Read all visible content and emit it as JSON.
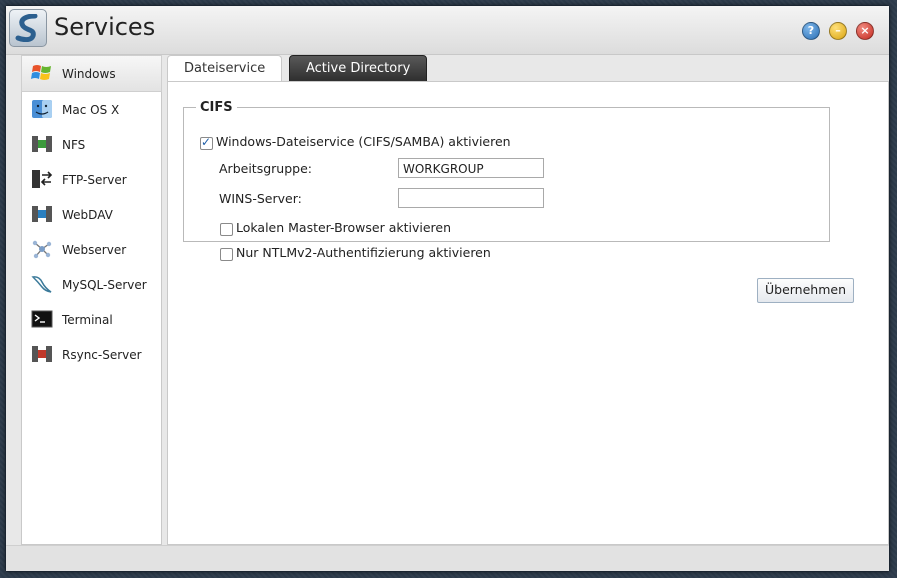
{
  "window": {
    "title": "Services"
  },
  "sidebar": {
    "items": [
      {
        "label": "Windows",
        "icon": "windows-logo-icon",
        "active": true
      },
      {
        "label": "Mac OS X",
        "icon": "mac-finder-icon"
      },
      {
        "label": "NFS",
        "icon": "nfs-server-icon"
      },
      {
        "label": "FTP-Server",
        "icon": "ftp-server-icon"
      },
      {
        "label": "WebDAV",
        "icon": "webdav-server-icon"
      },
      {
        "label": "Webserver",
        "icon": "webserver-icon"
      },
      {
        "label": "MySQL-Server",
        "icon": "mysql-dolphin-icon"
      },
      {
        "label": "Terminal",
        "icon": "terminal-icon"
      },
      {
        "label": "Rsync-Server",
        "icon": "rsync-server-icon"
      }
    ]
  },
  "tabs": [
    {
      "label": "Dateiservice",
      "active": true
    },
    {
      "label": "Active Directory",
      "active": false
    }
  ],
  "cifs": {
    "legend": "CIFS",
    "enable_label": "Windows-Dateiservice (CIFS/SAMBA) aktivieren",
    "enable_checked": true,
    "workgroup_label": "Arbeitsgruppe:",
    "workgroup_value": "WORKGROUP",
    "wins_label": "WINS-Server:",
    "wins_value": "",
    "master_browser_label": "Lokalen Master-Browser aktivieren",
    "master_browser_checked": false,
    "ntlmv2_label": "Nur NTLMv2-Authentifizierung aktivieren",
    "ntlmv2_checked": false
  },
  "actions": {
    "apply_label": "Übernehmen"
  },
  "colors": {
    "accent_blue": "#1f5fa8",
    "tab_dark": "#2d2d2d"
  }
}
